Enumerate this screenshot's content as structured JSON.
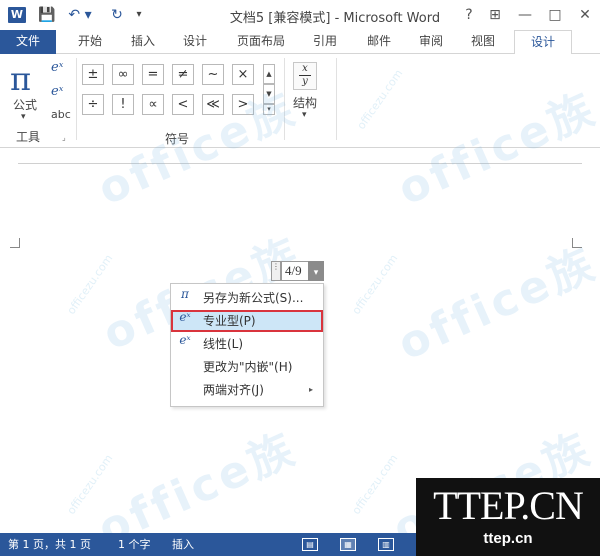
{
  "window": {
    "app_icon": "W",
    "title": "文档5 [兼容模式] - Microsoft Word",
    "help": "?",
    "ribbon_display": "⊞",
    "minimize": "—",
    "maximize": "□",
    "close": "✕"
  },
  "quick_access": {
    "save": "💾",
    "undo": "↶ ▾",
    "redo": "↻",
    "customize": "▾"
  },
  "tabs": [
    "文件",
    "开始",
    "插入",
    "设计",
    "页面布局",
    "引用",
    "邮件",
    "审阅",
    "视图",
    "设计"
  ],
  "ribbon": {
    "tools_group": {
      "equation_icon": "π",
      "equation_label": "公式",
      "equation_arrow": "▾",
      "ink_icon": "eˣ",
      "abc_label": "abc",
      "group_label": "工具"
    },
    "symbols_group": {
      "row1": [
        "±",
        "∞",
        "=",
        "≠",
        "~",
        "×"
      ],
      "row2": [
        "÷",
        "!",
        "∝",
        "<",
        "≪",
        ">"
      ],
      "scroll": [
        "▲",
        "▼",
        "▾"
      ],
      "group_label": "符号"
    },
    "structures_group": {
      "icon_top": "x",
      "icon_bottom": "y",
      "label": "结构",
      "arrow": "▾"
    }
  },
  "document": {
    "equation_text": "4/9",
    "equation_handle": "⋮",
    "equation_dropdown": "▾"
  },
  "context_menu": {
    "items": [
      {
        "label": "另存为新公式(S)...",
        "icon": "π",
        "highlighted": false
      },
      {
        "label": "专业型(P)",
        "icon": "eˣ",
        "highlighted": true
      },
      {
        "label": "线性(L)",
        "icon": "eˣ",
        "highlighted": false
      },
      {
        "label": "更改为\"内嵌\"(H)",
        "icon": "",
        "highlighted": false
      },
      {
        "label": "两端对齐(J)",
        "icon": "",
        "highlighted": false,
        "has_submenu": true
      }
    ],
    "submenu_arrow": "▸"
  },
  "status_bar": {
    "page": "第 1 页，共 1 页",
    "words": "1 个字",
    "mode": "插入"
  },
  "watermark": {
    "text": "office族",
    "site": "officezu.com"
  },
  "brand": {
    "main": "TTEP.CN",
    "sub": "ttep.cn"
  },
  "colors": {
    "accent": "#2b579a",
    "menu_highlight": "#cde6f7",
    "highlight_border": "#d9343d"
  }
}
